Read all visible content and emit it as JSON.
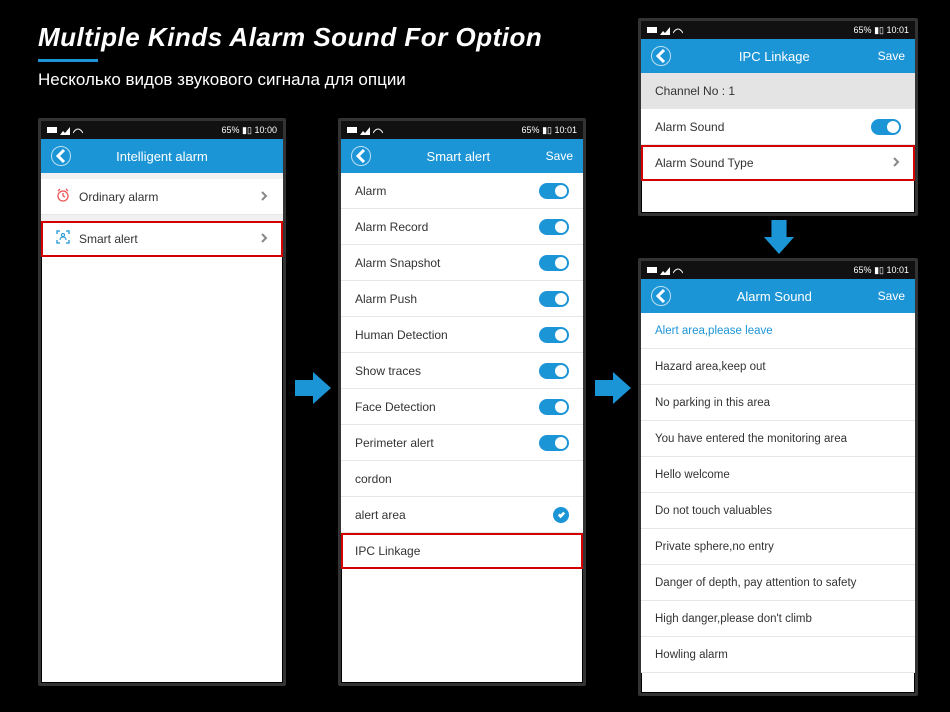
{
  "header": {
    "title": "Multiple Kinds Alarm Sound For Option",
    "subtitle": "Несколько видов звукового сигнала для опции"
  },
  "status": {
    "battery": "65%",
    "time1": "10:00",
    "time2": "10:01"
  },
  "nav": {
    "save": "Save"
  },
  "phone1": {
    "title": "Intelligent alarm",
    "rows": [
      {
        "label": "Ordinary alarm",
        "icon": "clock",
        "hl": false
      },
      {
        "label": "Smart alert",
        "icon": "scan",
        "hl": true
      }
    ]
  },
  "phone2": {
    "title": "Smart alert",
    "toggles": [
      "Alarm",
      "Alarm Record",
      "Alarm Snapshot",
      "Alarm Push",
      "Human Detection",
      "Show traces",
      "Face Detection",
      "Perimeter alert"
    ],
    "plain": [
      "cordon"
    ],
    "checked": "alert area",
    "hl": "IPC Linkage"
  },
  "phone3": {
    "title": "IPC Linkage",
    "channel": "Channel No : 1",
    "toggle_label": "Alarm Sound",
    "hl": "Alarm Sound Type"
  },
  "phone4": {
    "title": "Alarm Sound",
    "selected": "Alert area,please leave",
    "items": [
      "Hazard area,keep out",
      "No parking in this area",
      "You have entered the monitoring area",
      "Hello welcome",
      "Do not touch valuables",
      "Private sphere,no entry",
      "Danger of depth, pay attention to safety",
      "High danger,please don't climb",
      "Howling alarm"
    ]
  }
}
